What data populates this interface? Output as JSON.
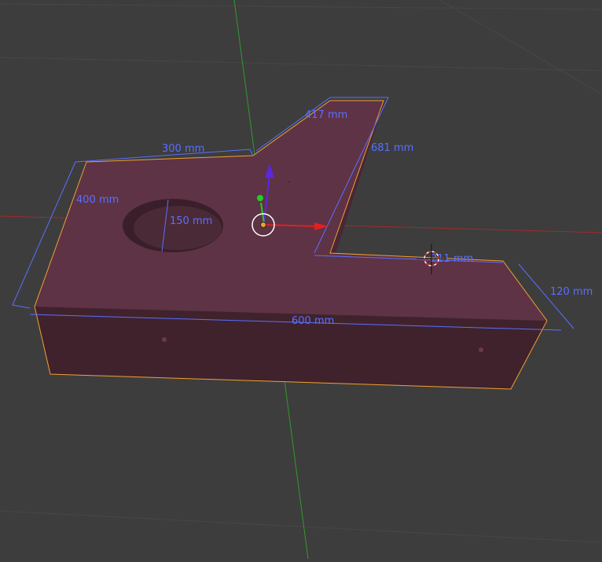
{
  "viewport": {
    "colors": {
      "background": "#3d3d3d",
      "grid": "#4a4a4a",
      "x_axis": "#b02a2a",
      "y_axis": "#2e9b2e",
      "top_face": "#5e3345",
      "front_face": "#40222d",
      "side_face": "#4c2838",
      "selection_outline": "#f0a030",
      "measurement": "#5a6fff",
      "gizmo_x": "#e02020",
      "gizmo_y": "#20d020",
      "gizmo_z": "#5a28e0",
      "cursor_red": "#e03030"
    },
    "dimensions": {
      "top_edge_left": "300 mm",
      "angled_edge_top": "417 mm",
      "angled_edge_right": "681 mm",
      "left_depth": "400 mm",
      "hole_diameter": "150 mm",
      "inner_edge": "211 mm",
      "front_width": "600 mm",
      "height": "120 mm"
    },
    "icons": {
      "transform_gizmo": "move-gizmo-icon",
      "cursor": "3d-cursor-icon",
      "origin": "object-origin-icon"
    }
  }
}
